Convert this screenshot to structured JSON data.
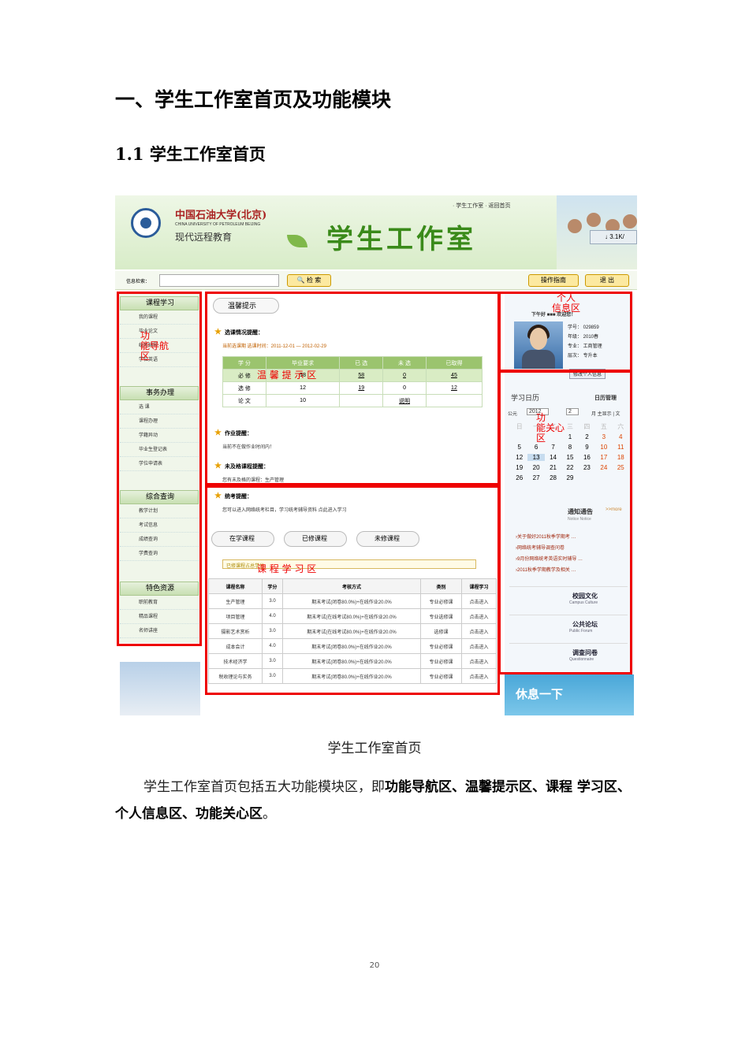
{
  "doc": {
    "h1": "一、学生工作室首页及功能模块",
    "h2": "1.1 学生工作室首页",
    "caption": "学生工作室首页",
    "para_pre": "学生工作室首页包括五大功能模块区，即",
    "para_bold": "功能导航区、温馨提示区、课程 学习区、个人信息区、功能关心区",
    "para_post": "。",
    "page_number": "20"
  },
  "shot": {
    "top_links": "· 学生工作室   · 返回首页",
    "univ_cn": "中国石油大学(北京)",
    "univ_en": "CHINA UNIVERSITY OF PETROLEUM BEIJING",
    "remote": "现代远程教育",
    "title": "学生工作室",
    "download": "↓ 3.1K/",
    "search_label": "信息检索：",
    "search_btn": "🔍 检 索",
    "guide_btn": "操作指南",
    "quit_btn": "退 出",
    "nav": [
      {
        "head": "课程学习",
        "items": [
          "我的课程",
          "毕业论文",
          "统考辅导",
          "学位英语"
        ]
      },
      {
        "head": "事务办理",
        "items": [
          "选 课",
          "课程办理",
          "学籍异动",
          "毕业生登记表",
          "学位申请表"
        ]
      },
      {
        "head": "综合查询",
        "items": [
          "教学计划",
          "考试信息",
          "成绩查询",
          "学费查询"
        ]
      },
      {
        "head": "特色资源",
        "items": [
          "职前教育",
          "精品课程",
          "名师讲座"
        ]
      }
    ],
    "labels": {
      "nav": "功\n能导航\n区",
      "tip": "温 馨 提 示 区",
      "course": "课 程 学 习 区",
      "info": "个人\n信息区",
      "care": "功\n能关心\n区"
    },
    "tips": {
      "head": "温馨提示",
      "select_title": "选课情况提醒：",
      "select_range": "当前选课期 选课时间：2011-12-01 — 2012-02-29",
      "table_head": [
        "学  分",
        "毕业要求",
        "已 选",
        "未 选",
        "已取得"
      ],
      "table_rows": [
        [
          "必 修",
          "58",
          "58",
          "0",
          "45"
        ],
        [
          "选 修",
          "12",
          "19",
          "0",
          "12"
        ],
        [
          "论 文",
          "10",
          "",
          "说明",
          ""
        ]
      ],
      "hw_title": "作业提醒：",
      "hw_text": "当前不在做作业时间内！",
      "fail_title": "未及格课程提醒：",
      "fail_text": "您有未及格的课程：生产管理",
      "exam_title": "统考提醒：",
      "exam_text": "您可以进入网络统考栏目，学习统考辅导资料 点此进入学习"
    },
    "course": {
      "tabs": [
        "在学课程",
        "已修课程",
        "未修课程"
      ],
      "progress": "已修课程占总学分",
      "head": [
        "课程名称",
        "学分",
        "考核方式",
        "类别",
        "课程学习"
      ],
      "rows": [
        [
          "生产管理",
          "3.0",
          "期末考试(闭卷80.0%)+在线作业20.0%",
          "专业必修课",
          "点击进入"
        ],
        [
          "项目管理",
          "4.0",
          "期末考试(在线考试80.0%)+在线作业20.0%",
          "专业选修课",
          "点击进入"
        ],
        [
          "摄影艺术赏析",
          "3.0",
          "期末考试(在线考试80.0%)+在线作业20.0%",
          "选修课",
          "点击进入"
        ],
        [
          "成本会计",
          "4.0",
          "期末考试(闭卷80.0%)+在线作业20.0%",
          "专业必修课",
          "点击进入"
        ],
        [
          "技术经济学",
          "3.0",
          "期末考试(闭卷80.0%)+在线作业20.0%",
          "专业必修课",
          "点击进入"
        ],
        [
          "税收理论与实务",
          "3.0",
          "期末考试(闭卷80.0%)+在线作业20.0%",
          "专业必修课",
          "点击进入"
        ]
      ]
    },
    "info": {
      "greet": "下午好 ■■■ 欢迎您！",
      "id": "学号：  029859",
      "grade": "年级：  2010春",
      "major": "专业：  工商管理",
      "level": "层次：  专升本",
      "edit": "修改个人信息"
    },
    "calendar": {
      "title": "学习日历",
      "manage": "日历管理",
      "year": "2012",
      "month": "2",
      "prefix": "公元",
      "suffix": "月  主显示 | 文",
      "weekdays": [
        "日",
        "一",
        "二",
        "三",
        "四",
        "五",
        "六"
      ],
      "days": [
        "",
        "",
        "",
        "1",
        "2",
        "3",
        "4",
        "5",
        "6",
        "7",
        "8",
        "9",
        "10",
        "11",
        "12",
        "13",
        "14",
        "15",
        "16",
        "17",
        "18",
        "19",
        "20",
        "21",
        "22",
        "23",
        "24",
        "25",
        "26",
        "27",
        "28",
        "29",
        "",
        "",
        ""
      ]
    },
    "notice": {
      "title": "通知通告",
      "en": "Notice Notice",
      "more": ">>more",
      "items": [
        "›关于做好2011秋季学期考 …",
        "›网络统考辅导调查问卷",
        "›9月份网络统考英语实时辅导 …",
        "›2011秋季学期教学及相关 …"
      ]
    },
    "modules": [
      {
        "cn": "校园文化",
        "en": "Campus Culture"
      },
      {
        "cn": "公共论坛",
        "en": "Public Forum"
      },
      {
        "cn": "调查问卷",
        "en": "Questionnaire"
      }
    ],
    "rest": "休息一下"
  }
}
